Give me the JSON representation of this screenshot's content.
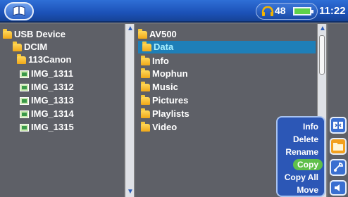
{
  "status_bar": {
    "volume": "48",
    "time": "11:22"
  },
  "icons": {
    "home": "archos-home-icon",
    "headphone": "headphone-icon",
    "battery": "battery-icon"
  },
  "left_pane": {
    "items": [
      {
        "label": "USB Device",
        "type": "folder"
      },
      {
        "label": "DCIM",
        "type": "folder"
      },
      {
        "label": "113Canon",
        "type": "folder"
      },
      {
        "label": "IMG_1311",
        "type": "image"
      },
      {
        "label": "IMG_1312",
        "type": "image"
      },
      {
        "label": "IMG_1313",
        "type": "image"
      },
      {
        "label": "IMG_1314",
        "type": "image"
      },
      {
        "label": "IMG_1315",
        "type": "image"
      }
    ]
  },
  "right_pane": {
    "items": [
      {
        "label": "AV500",
        "type": "folder"
      },
      {
        "label": "Data",
        "type": "folder",
        "selected": true
      },
      {
        "label": "Info",
        "type": "folder"
      },
      {
        "label": "Mophun",
        "type": "folder"
      },
      {
        "label": "Music",
        "type": "folder"
      },
      {
        "label": "Pictures",
        "type": "folder"
      },
      {
        "label": "Playlists",
        "type": "folder"
      },
      {
        "label": "Video",
        "type": "folder"
      }
    ]
  },
  "context_menu": {
    "items": [
      "Info",
      "Delete",
      "Rename",
      "Copy",
      "Copy All",
      "Move"
    ],
    "active": "Copy"
  },
  "side_buttons": [
    "split-view-icon",
    "folder-icon",
    "settings-icon",
    "speaker-icon"
  ]
}
